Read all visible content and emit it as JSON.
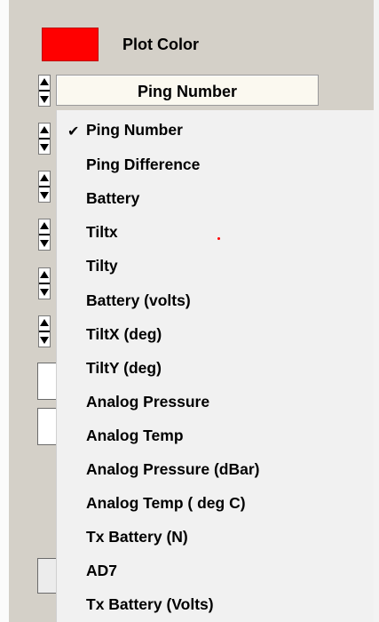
{
  "plot_color": {
    "label": "Plot Color",
    "swatch_color": "#ff0000"
  },
  "selector": {
    "selected": "Ping Number"
  },
  "menu": {
    "checked_index": 0,
    "items": [
      "Ping Number",
      "Ping Difference",
      "Battery",
      "Tiltx",
      "Tilty",
      "Battery (volts)",
      "TiltX (deg)",
      "TiltY (deg)",
      "Analog Pressure",
      "Analog Temp",
      "Analog Pressure (dBar)",
      "Analog Temp ( deg C)",
      "Tx Battery (N)",
      "AD7",
      "Tx Battery (Volts)"
    ]
  },
  "icons": {
    "check": "check-icon",
    "spinner": "spinner-arrows-icon"
  }
}
